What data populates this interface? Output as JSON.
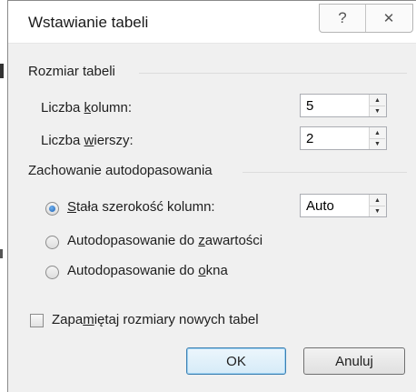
{
  "dialog": {
    "title": "Wstawianie tabeli",
    "help_glyph": "?",
    "close_glyph": "✕"
  },
  "table_size": {
    "group_label": "Rozmiar tabeli",
    "columns": {
      "label_pre": "Liczba ",
      "label_u": "k",
      "label_post": "olumn:",
      "value": "5"
    },
    "rows": {
      "label_pre": "Liczba ",
      "label_u": "w",
      "label_post": "ierszy:",
      "value": "2"
    }
  },
  "autofit": {
    "group_label": "Zachowanie autodopasowania",
    "fixed": {
      "label_u": "S",
      "label_post": "tała szerokość kolumn:",
      "value": "Auto",
      "selected": true
    },
    "contents": {
      "label_pre": "Autodopasowanie do ",
      "label_u": "z",
      "label_post": "awartości",
      "selected": false
    },
    "window": {
      "label_pre": "Autodopasowanie do ",
      "label_u": "o",
      "label_post": "kna",
      "selected": false
    }
  },
  "remember": {
    "label_pre": "Zapa",
    "label_u": "m",
    "label_post": "iętaj rozmiary nowych tabel",
    "checked": false
  },
  "buttons": {
    "ok": "OK",
    "cancel": "Anuluj"
  },
  "icons": {
    "spin_up": "▲",
    "spin_down": "▼"
  }
}
